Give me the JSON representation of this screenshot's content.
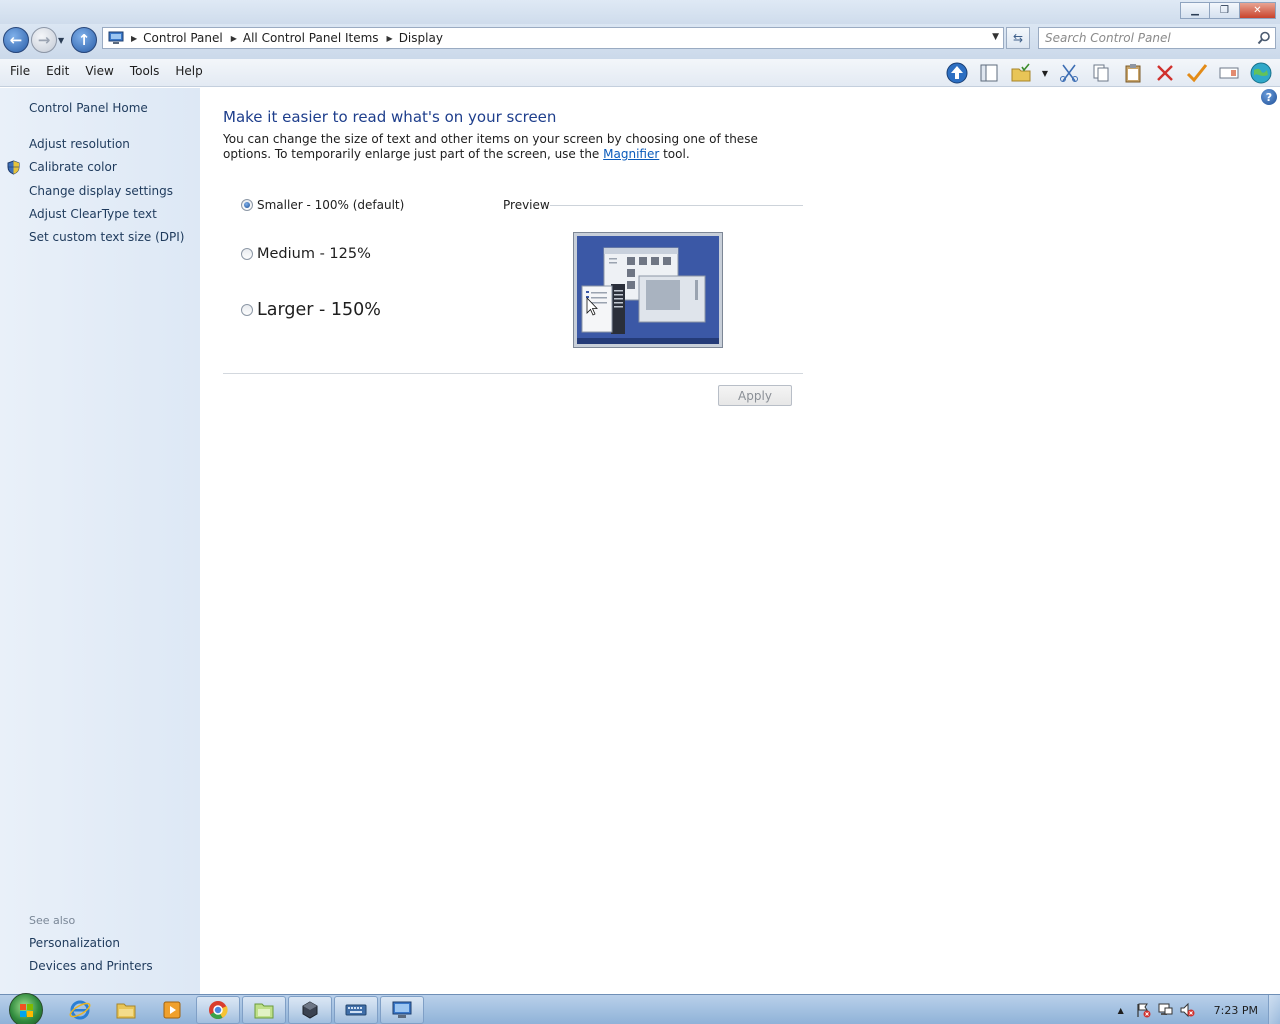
{
  "window": {
    "minimize_glyph": "▁",
    "restore_glyph": "❐",
    "close_glyph": "✕"
  },
  "address": {
    "crumbs": [
      "Control Panel",
      "All Control Panel Items",
      "Display"
    ],
    "search_placeholder": "Search Control Panel"
  },
  "menu": [
    "File",
    "Edit",
    "View",
    "Tools",
    "Help"
  ],
  "left_pane": {
    "home": "Control Panel Home",
    "links": [
      "Adjust resolution",
      "Calibrate color",
      "Change display settings",
      "Adjust ClearType text",
      "Set custom text size (DPI)"
    ],
    "see_also_label": "See also",
    "see_also": [
      "Personalization",
      "Devices and Printers"
    ]
  },
  "content": {
    "heading": "Make it easier to read what's on your screen",
    "desc_before": "You can change the size of text and other items on your screen by choosing one of these options. To temporarily enlarge just part of the screen, use the ",
    "desc_link": "Magnifier",
    "desc_after": " tool.",
    "options": [
      {
        "label": "Smaller - 100% (default)",
        "selected": true
      },
      {
        "label": "Medium - 125%",
        "selected": false
      },
      {
        "label": "Larger - 150%",
        "selected": false
      }
    ],
    "preview_label": "Preview",
    "apply_label": "Apply",
    "help_glyph": "?"
  },
  "taskbar": {
    "clock": "7:23 PM"
  },
  "colors": {
    "heading": "#1e3e8c",
    "link": "#0a5bbb",
    "left_link": "#1e3a5c"
  }
}
